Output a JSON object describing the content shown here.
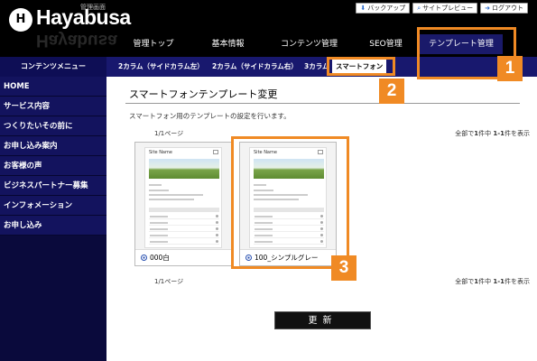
{
  "app": {
    "logo_mark": "H",
    "name": "Hayabusa",
    "subtitle": "管理画面"
  },
  "top_buttons": [
    {
      "icon": "download-icon",
      "label": "バックアップ"
    },
    {
      "icon": "search-icon",
      "label": "サイトプレビュー"
    },
    {
      "icon": "logout-icon",
      "label": "ログアウト"
    }
  ],
  "main_nav": [
    "管理トップ",
    "基本情報",
    "コンテンツ管理",
    "SEO管理",
    "テンプレート管理"
  ],
  "sub_nav": {
    "left_label": "コンテンツメニュー",
    "tabs": [
      "2カラム（サイドカラム左）",
      "2カラム（サイドカラム右）",
      "3カラム",
      "スマートフォン"
    ]
  },
  "sidebar": {
    "items": [
      "HOME",
      "サービス内容",
      "つくりたいその前に",
      "お申し込み案内",
      "お客様の声",
      "ビジネスパートナー募集",
      "インフォメーション",
      "お申し込み"
    ]
  },
  "content": {
    "title": "スマートフォンテンプレート変更",
    "description": "スマートフォン用のテンプレートの設定を行います。",
    "pager": "1/1ページ",
    "count_prefix": "全部で",
    "count_total": "1",
    "count_mid": "件中 ",
    "count_range": "1-1",
    "count_suffix": "件を表示",
    "templates": [
      {
        "name": "000白",
        "preview_site_name": "Site Name"
      },
      {
        "name": "100_シンプルグレー",
        "preview_site_name": "Site Name"
      }
    ],
    "update_button": "更新"
  },
  "callouts": [
    "1",
    "2",
    "3"
  ],
  "colors": {
    "header_bg": "#000000",
    "nav_dark": "#18186e",
    "sidebar_bg": "#13135e",
    "callout": "#f08a24",
    "radio": "#2850b0"
  }
}
